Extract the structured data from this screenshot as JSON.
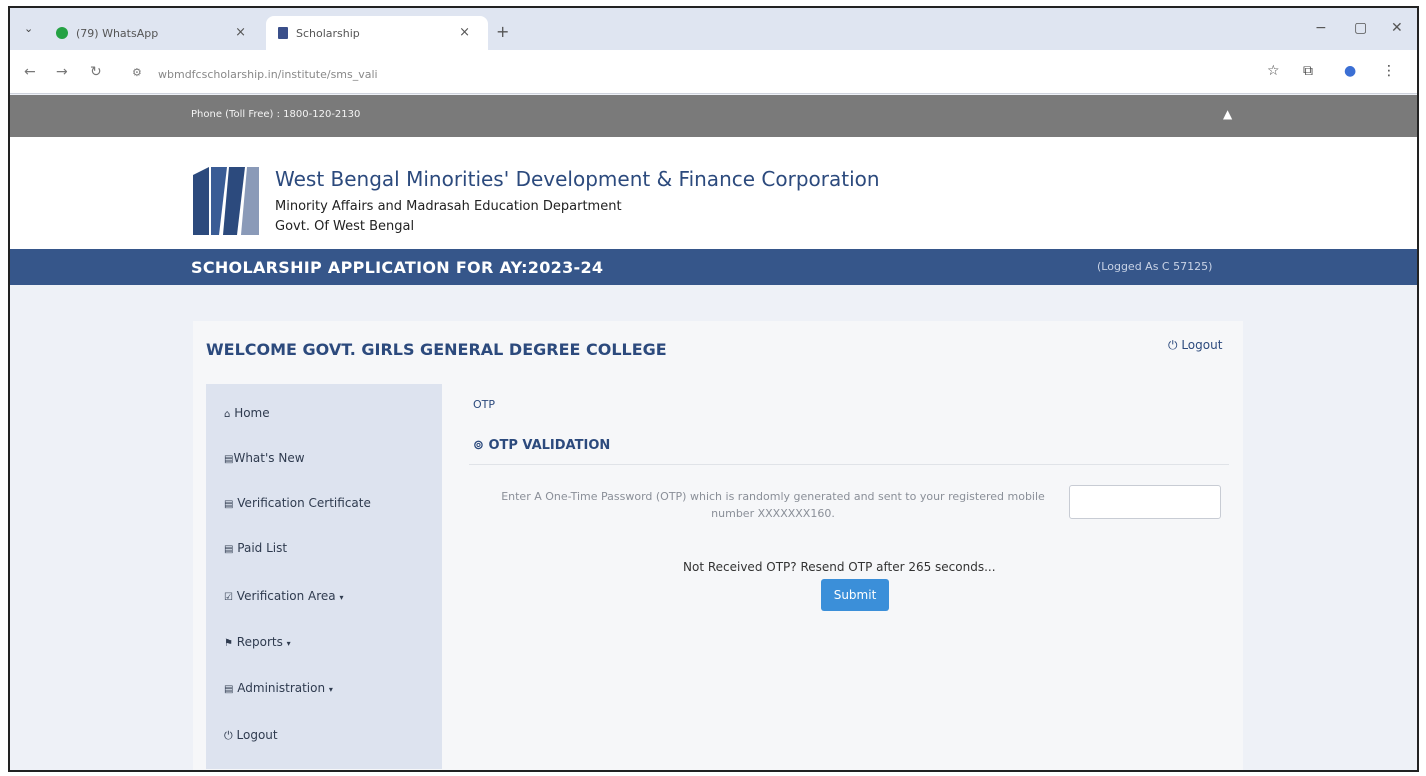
{
  "browser": {
    "tabs": [
      {
        "title": "(79) WhatsApp"
      },
      {
        "title": "Scholarship"
      }
    ],
    "new_tab": "+",
    "url": "wbmdfcscholarship.in/institute/sms_vali"
  },
  "topbar": {
    "phone": "Phone (Toll Free) : 1800-120-2130"
  },
  "header": {
    "title": "West Bengal Minorities' Development & Finance Corporation",
    "subtitle1": "Minority Affairs and Madrasah Education Department",
    "subtitle2": "Govt. Of West Bengal"
  },
  "banner": {
    "title": "SCHOLARSHIP APPLICATION FOR AY:2023-24",
    "logged_as": "(Logged As C 57125)"
  },
  "card": {
    "welcome": "WELCOME GOVT. GIRLS GENERAL DEGREE COLLEGE",
    "logout": "Logout"
  },
  "sidebar": {
    "items": [
      {
        "label": "Home"
      },
      {
        "label": "What's New"
      },
      {
        "label": "Verification Certificate"
      },
      {
        "label": "Paid List"
      },
      {
        "label": "Verification Area"
      },
      {
        "label": "Reports"
      },
      {
        "label": "Administration"
      },
      {
        "label": "Logout"
      }
    ]
  },
  "main": {
    "breadcrumb": "OTP",
    "section_title": "OTP VALIDATION",
    "otp_label": "Enter A One-Time Password (OTP) which is randomly generated and sent to your registered mobile number XXXXXXX160.",
    "otp_value": "",
    "resend_text": "Not Received OTP? Resend OTP after 265 seconds...",
    "submit_label": "Submit"
  },
  "colors": {
    "brand_blue": "#36568a",
    "link_blue": "#2c4a7d",
    "button_blue": "#3b8fd9",
    "topbar_gray": "#7a7a7a"
  }
}
